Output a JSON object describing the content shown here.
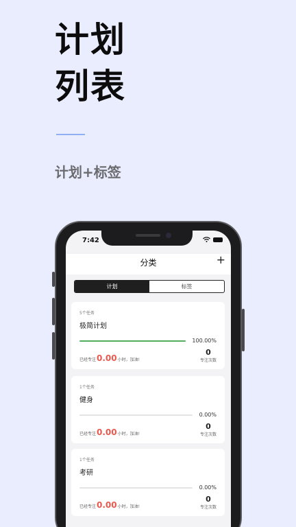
{
  "hero": {
    "title_line1": "计划",
    "title_line2": "列表",
    "subtitle": "计划+标签"
  },
  "status_bar": {
    "time": "7:42"
  },
  "appbar": {
    "title": "分类",
    "add_label": "+"
  },
  "segments": [
    {
      "label": "计划",
      "active": true
    },
    {
      "label": "标签",
      "active": false
    }
  ],
  "cards": [
    {
      "count": "5个任务",
      "title": "极简计划",
      "progress_pct": 100,
      "progress_text": "100.00%",
      "focus_prefix": "已经专注",
      "hours": "0.00",
      "focus_suffix": "小时，加油!",
      "times": "0",
      "times_label": "专注次数"
    },
    {
      "count": "1个任务",
      "title": "健身",
      "progress_pct": 0,
      "progress_text": "0.00%",
      "focus_prefix": "已经专注",
      "hours": "0.00",
      "focus_suffix": "小时，加油!",
      "times": "0",
      "times_label": "专注次数"
    },
    {
      "count": "1个任务",
      "title": "考研",
      "progress_pct": 0,
      "progress_text": "0.00%",
      "focus_prefix": "已经专注",
      "hours": "0.00",
      "focus_suffix": "小时，加油!",
      "times": "0",
      "times_label": "专注次数"
    }
  ],
  "colors": {
    "background": "#e9edfd",
    "accent_line": "#8fb0f2",
    "progress_fill": "#52ad5c",
    "hours_text": "#e8594f"
  }
}
